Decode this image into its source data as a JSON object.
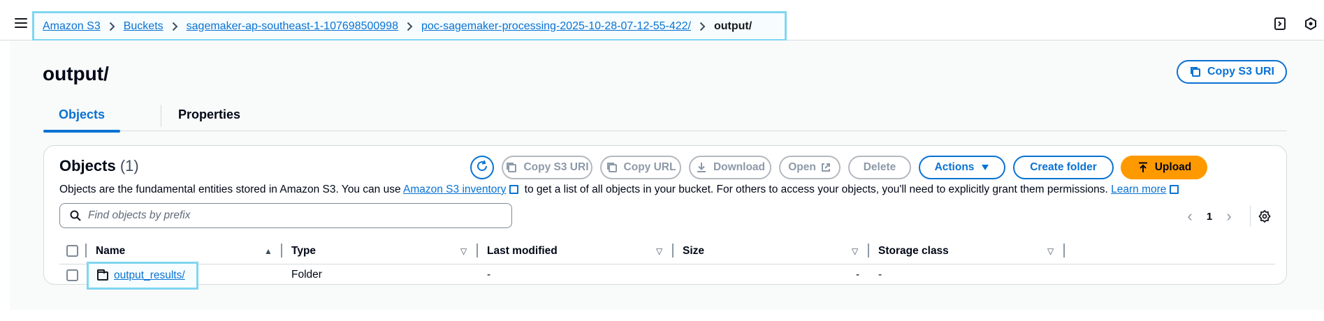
{
  "breadcrumb": {
    "items": [
      "Amazon S3",
      "Buckets",
      "sagemaker-ap-southeast-1-107698500998",
      "poc-sagemaker-processing-2025-10-28-07-12-55-422/"
    ],
    "current": "output/"
  },
  "page": {
    "title": "output/",
    "copy_uri_label": "Copy S3 URI"
  },
  "tabs": [
    {
      "label": "Objects",
      "active": true
    },
    {
      "label": "Properties",
      "active": false
    }
  ],
  "objects_panel": {
    "title": "Objects",
    "count": "(1)",
    "desc_before": "Objects are the fundamental entities stored in Amazon S3. You can use ",
    "desc_link": "Amazon S3 inventory",
    "desc_middle": " to get a list of all objects in your bucket. For others to access your objects, you'll need to explicitly grant them permissions. ",
    "desc_learn_more": "Learn more",
    "buttons": {
      "copy_s3_uri": "Copy S3 URI",
      "copy_url": "Copy URL",
      "download": "Download",
      "open": "Open",
      "delete": "Delete",
      "actions": "Actions",
      "create_folder": "Create folder",
      "upload": "Upload"
    },
    "search": {
      "placeholder": "Find objects by prefix",
      "value": ""
    },
    "pagination": {
      "current_page": "1"
    },
    "columns": [
      "Name",
      "Type",
      "Last modified",
      "Size",
      "Storage class"
    ],
    "rows": [
      {
        "name": "output_results/",
        "type": "Folder",
        "last_modified": "-",
        "size": "-",
        "storage_class": "-"
      }
    ]
  },
  "icons": [
    "menu-icon",
    "refresh-icon",
    "copy-icon",
    "download-icon",
    "external-link-icon",
    "caret-down-icon",
    "upload-icon",
    "search-icon",
    "chevron-left-icon",
    "chevron-right-icon",
    "settings-icon",
    "folder-icon",
    "sort-ascending-icon",
    "sort-icon"
  ],
  "colors": {
    "accent": "#0972d3",
    "upload": "#ff9900",
    "highlight": "#7fd6f0"
  }
}
